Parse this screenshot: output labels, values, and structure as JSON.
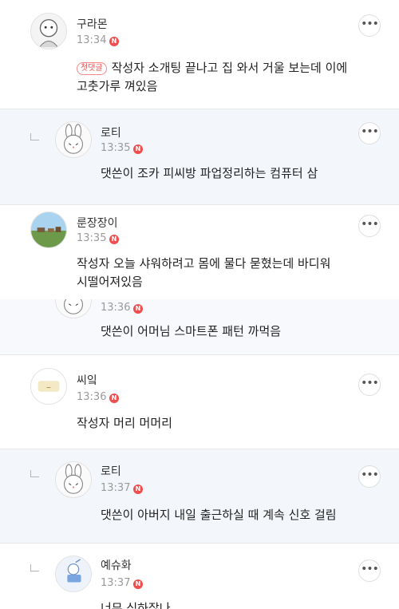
{
  "comments": [
    {
      "author": "구라몬",
      "time": "13:34",
      "new_badge": "N",
      "first_badge": "첫댓글",
      "lines": [
        "작성자 소개팅 끝나고 집 와서 거울 보는데 이에",
        "고춧가루 껴있음"
      ],
      "more": "•••"
    },
    {
      "author": "로티",
      "time": "13:35",
      "new_badge": "N",
      "lines": [
        "댓쓴이 조카 피씨방 파업정리하는 컴퓨터 삼"
      ],
      "more": "•••"
    },
    {
      "author": "룬장장이",
      "time": "13:35",
      "new_badge": "N",
      "lines": [
        "작성자 오늘 샤워하려고 몸에 물다 묻혔는데 바디워",
        "시떨어져있음"
      ],
      "more": "•••"
    },
    {
      "time": "13:36",
      "new_badge": "N",
      "lines": [
        "댓쓴이 어머님 스마트폰 패턴 까먹음"
      ]
    },
    {
      "author": "씨잌",
      "time": "13:36",
      "new_badge": "N",
      "lines": [
        "작성자 머리 머머리"
      ],
      "more": "•••"
    },
    {
      "author": "로티",
      "time": "13:37",
      "new_badge": "N",
      "lines": [
        "댓쓴이 아버지 내일 출근하실 때 계속 신호 걸림"
      ],
      "more": "•••"
    },
    {
      "author": "예슈화",
      "time": "13:37",
      "new_badge": "N",
      "lines": [
        "너무 심하잖나"
      ],
      "more": "•••"
    }
  ]
}
